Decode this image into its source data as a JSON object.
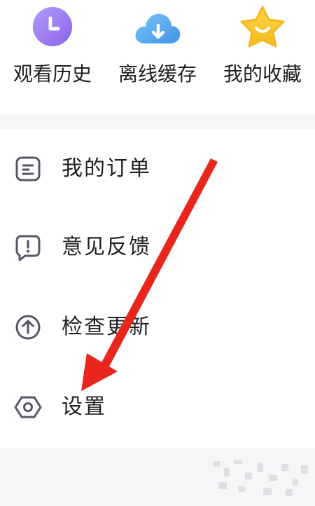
{
  "quick_actions": [
    {
      "label": "观看历史",
      "icon": "clock-icon",
      "color": "#9b7bf0"
    },
    {
      "label": "离线缓存",
      "icon": "cloud-download-icon",
      "color": "#5aaef0"
    },
    {
      "label": "我的收藏",
      "icon": "star-icon",
      "color": "#f7c52b"
    }
  ],
  "menu": {
    "items": [
      {
        "label": "我的订单",
        "icon": "order-icon"
      },
      {
        "label": "意见反馈",
        "icon": "feedback-icon"
      },
      {
        "label": "检查更新",
        "icon": "upload-arrow-icon"
      },
      {
        "label": "设置",
        "icon": "hexagon-settings-icon"
      }
    ]
  },
  "colors": {
    "text": "#1f1f24",
    "icon_stroke": "#55566a",
    "annotation_arrow": "#e8261c",
    "page_background": "#f6f6f8"
  }
}
